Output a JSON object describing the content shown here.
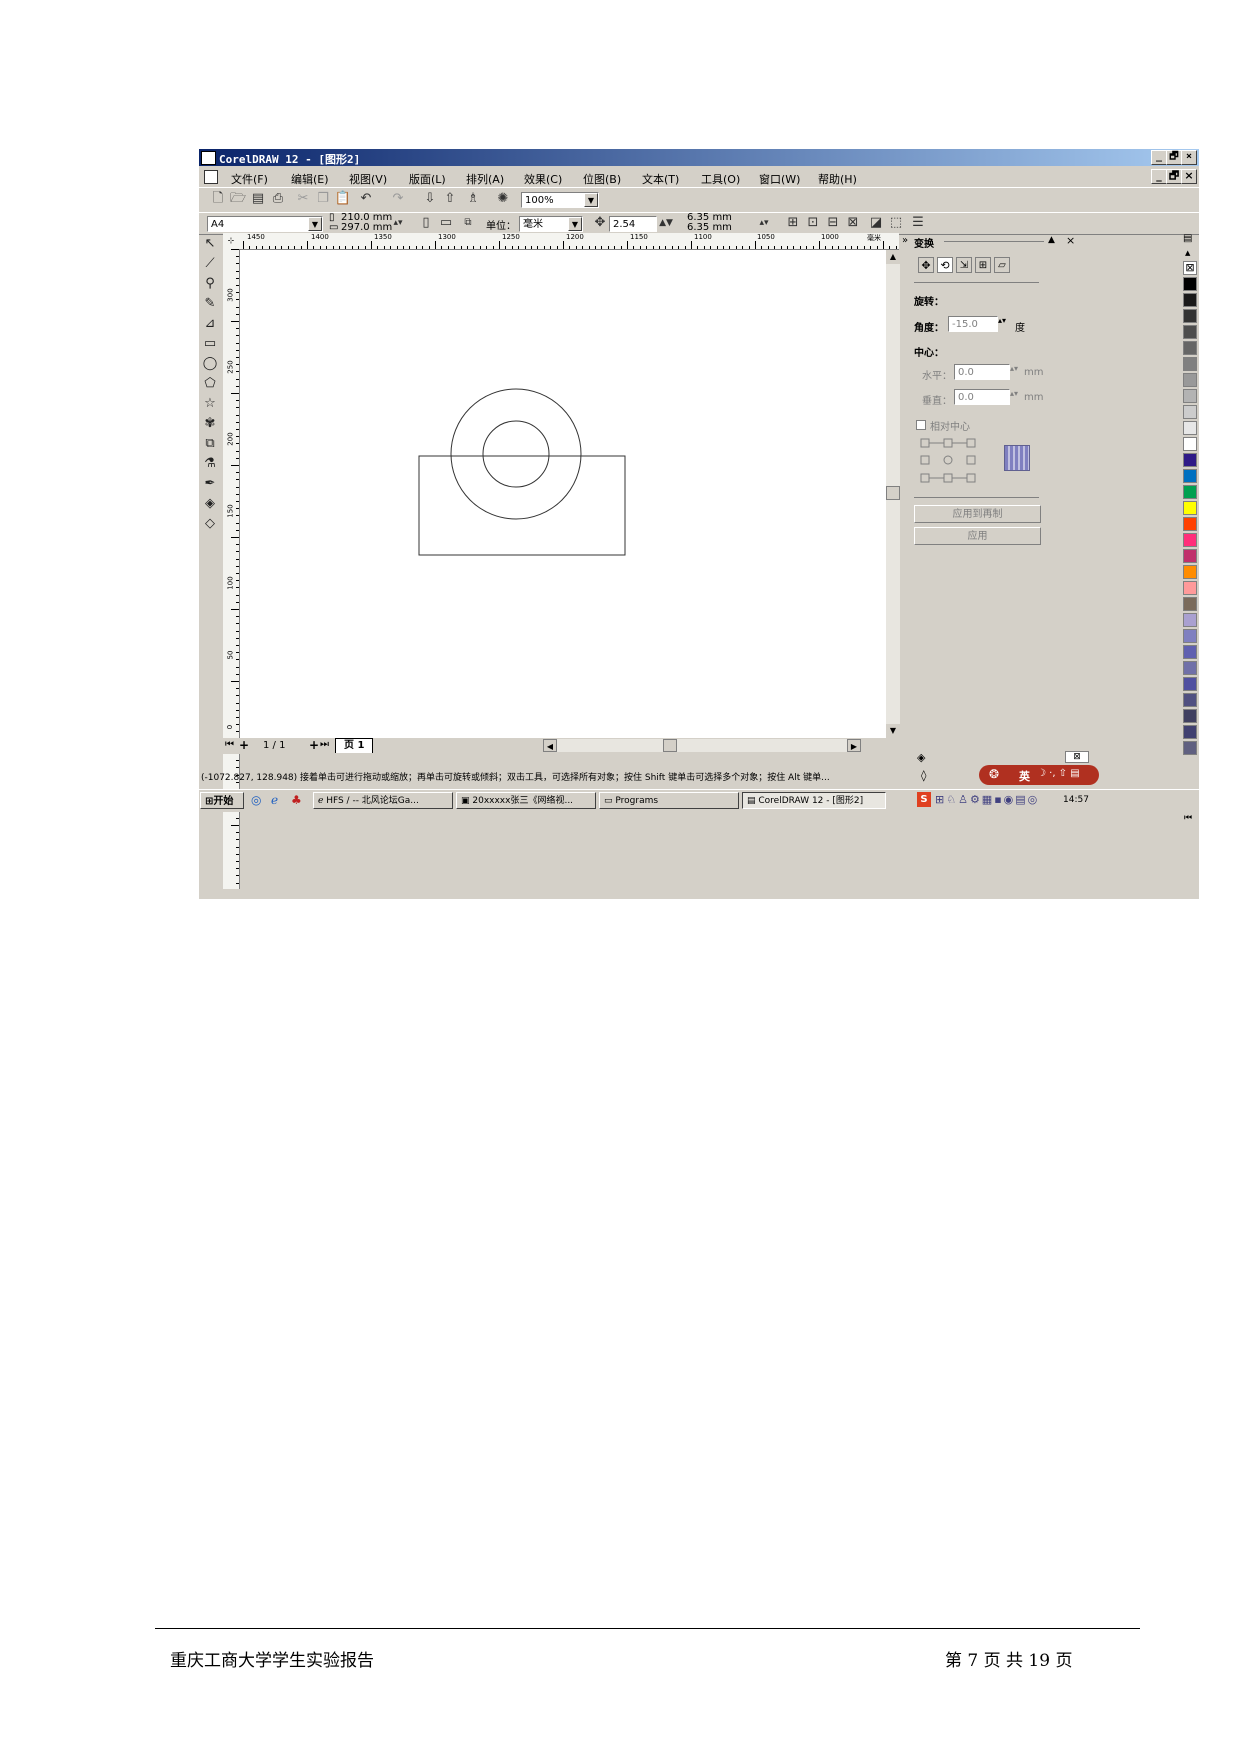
{
  "window": {
    "title": "CorelDRAW 12 - [图形2]",
    "controls": [
      "_",
      "🗗",
      "×"
    ]
  },
  "menu": [
    "文件(F)",
    "编辑(E)",
    "视图(V)",
    "版面(L)",
    "排列(A)",
    "效果(C)",
    "位图(B)",
    "文本(T)",
    "工具(O)",
    "窗口(W)",
    "帮助(H)"
  ],
  "toolbar": {
    "zoom": "100%",
    "paper": "A4",
    "width": "210.0 mm",
    "height": "297.0 mm",
    "unit_label": "单位：",
    "unit": "毫米",
    "nudge": "2.54 mm",
    "dup_x": "6.35 mm",
    "dup_y": "6.35 mm"
  },
  "rulers": {
    "h_ticks": [
      "1450",
      "1400",
      "1350",
      "1300",
      "1250",
      "1200",
      "1150",
      "1100",
      "1050",
      "1000"
    ],
    "h_unit": "毫米",
    "v_ticks": [
      "300",
      "250",
      "200",
      "150",
      "100",
      "50",
      "0"
    ]
  },
  "pagebar": {
    "count": "1 / 1",
    "tab": "页 1"
  },
  "docker": {
    "title": "变换",
    "section_rotate": "旋转：",
    "angle_label": "角度：",
    "angle_value": "-15.0",
    "angle_unit": "度",
    "center_label": "中心：",
    "h_label": "水平：",
    "h_value": "0.0",
    "v_label": "垂直：",
    "v_value": "0.0",
    "mm": "mm",
    "relative_center": "相对中心",
    "apply_dup": "应用到再制",
    "apply": "应用"
  },
  "palette": [
    "#000000",
    "#1a1a1a",
    "#333333",
    "#4d4d4d",
    "#666666",
    "#808080",
    "#999999",
    "#b3b3b3",
    "#cccccc",
    "#e6e6e6",
    "#ffffff",
    "#2e1a87",
    "#0070c0",
    "#00a050",
    "#ffff00",
    "#ff4000",
    "#ff2d7a",
    "#c0306b",
    "#ff8c00",
    "#ff9a9a",
    "#7a6a5a",
    "#a9a0d0",
    "#8080c0",
    "#6060b0",
    "#7070a8",
    "#5050a0",
    "#505080",
    "#404060",
    "#404070",
    "#606080"
  ],
  "status": {
    "text": "(-1072.827, 128.948) 接着单击可进行拖动或缩放；再单击可旋转或倾斜；双击工具，可选择所有对象；按住 Shift 键单击可选择多个对象；按住 Alt 键单...",
    "ime": "英"
  },
  "taskbar": {
    "start": "开始",
    "tasks": [
      "HFS / -- 北风论坛Ga...",
      "20xxxxx张三《网络视...",
      "Programs",
      "CorelDRAW 12 - [图形2]"
    ],
    "clock": "14:57"
  },
  "footer": {
    "left": "重庆工商大学学生实验报告",
    "right": "第 7 页 共 19 页"
  }
}
